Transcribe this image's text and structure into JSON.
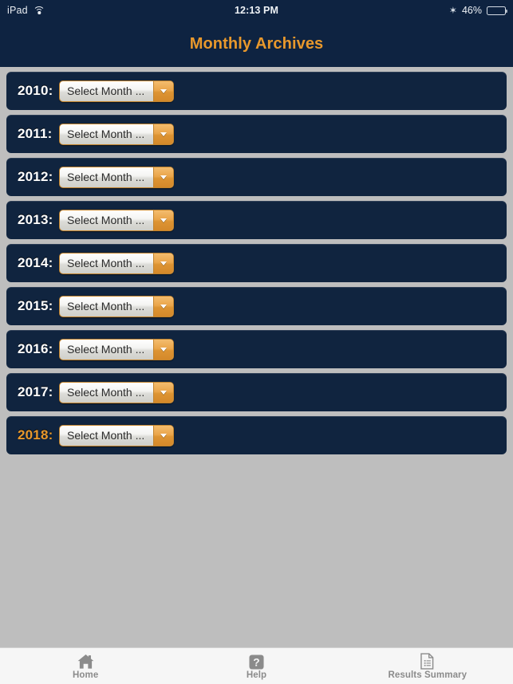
{
  "status_bar": {
    "device": "iPad",
    "wifi_icon": "wifi-icon",
    "time": "12:13 PM",
    "bluetooth_icon": "bluetooth-icon",
    "battery_percent": "46%",
    "battery_icon": "battery-icon",
    "battery_level": 46
  },
  "header": {
    "title": "Monthly Archives"
  },
  "colors": {
    "accent_orange": "#e8982c",
    "navy_header": "#0e2341",
    "navy_row": "#10243f",
    "page_background": "#bebebe",
    "tab_bar_background": "#f6f6f6",
    "tab_label": "#8b8b8b"
  },
  "archives": {
    "rows": [
      {
        "year": "2010:",
        "select_value": "Select Month ...",
        "highlighted": false
      },
      {
        "year": "2011:",
        "select_value": "Select Month ...",
        "highlighted": false
      },
      {
        "year": "2012:",
        "select_value": "Select Month ...",
        "highlighted": false
      },
      {
        "year": "2013:",
        "select_value": "Select Month ...",
        "highlighted": false
      },
      {
        "year": "2014:",
        "select_value": "Select Month ...",
        "highlighted": false
      },
      {
        "year": "2015:",
        "select_value": "Select Month ...",
        "highlighted": false
      },
      {
        "year": "2016:",
        "select_value": "Select Month ...",
        "highlighted": false
      },
      {
        "year": "2017:",
        "select_value": "Select Month ...",
        "highlighted": false
      },
      {
        "year": "2018:",
        "select_value": "Select Month ...",
        "highlighted": true
      }
    ]
  },
  "tab_bar": {
    "items": [
      {
        "label": "Home",
        "icon": "home-icon"
      },
      {
        "label": "Help",
        "icon": "question-mark-icon"
      },
      {
        "label": "Results Summary",
        "icon": "document-icon"
      }
    ]
  }
}
